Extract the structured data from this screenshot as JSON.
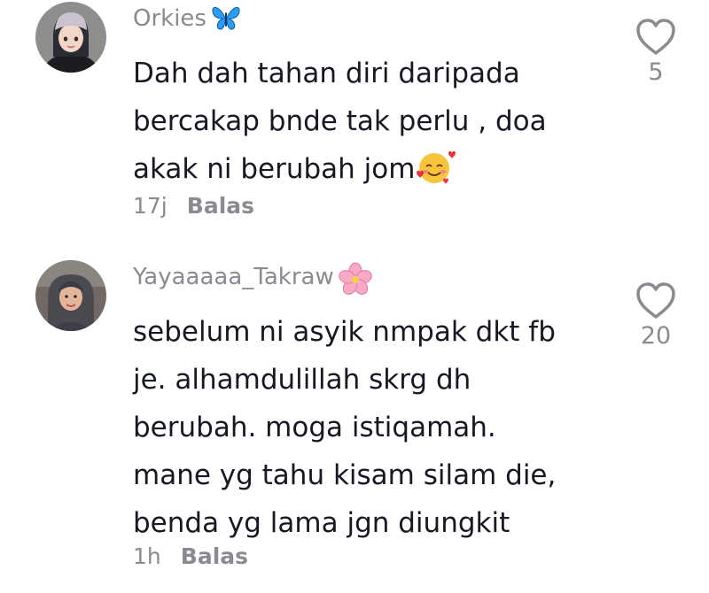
{
  "comments": [
    {
      "username": "Orkies",
      "username_emoji": "butterfly-emoji",
      "text_lines": [
        "Dah dah tahan diri daripada",
        "bercakap bnde tak perlu , doa",
        "akak ni berubah jom"
      ],
      "text_emoji": "smiling-face-with-hearts-emoji",
      "time": "17j",
      "reply_label": "Balas",
      "likes": "5",
      "like_icon": "heart-outline-icon"
    },
    {
      "username": "Yayaaaaa_Takraw",
      "username_emoji": "cherry-blossom-emoji",
      "text_lines": [
        "sebelum ni asyik nmpak dkt fb",
        "je. alhamdulillah skrg dh",
        "berubah. moga istiqamah.",
        "mane yg tahu kisam silam die,",
        "benda yg lama jgn diungkit"
      ],
      "time": "1h",
      "reply_label": "Balas",
      "likes": "20",
      "like_icon": "heart-outline-icon"
    }
  ],
  "colors": {
    "primary_text": "#161823",
    "secondary_text": "#8a8b91",
    "background": "#ffffff"
  }
}
